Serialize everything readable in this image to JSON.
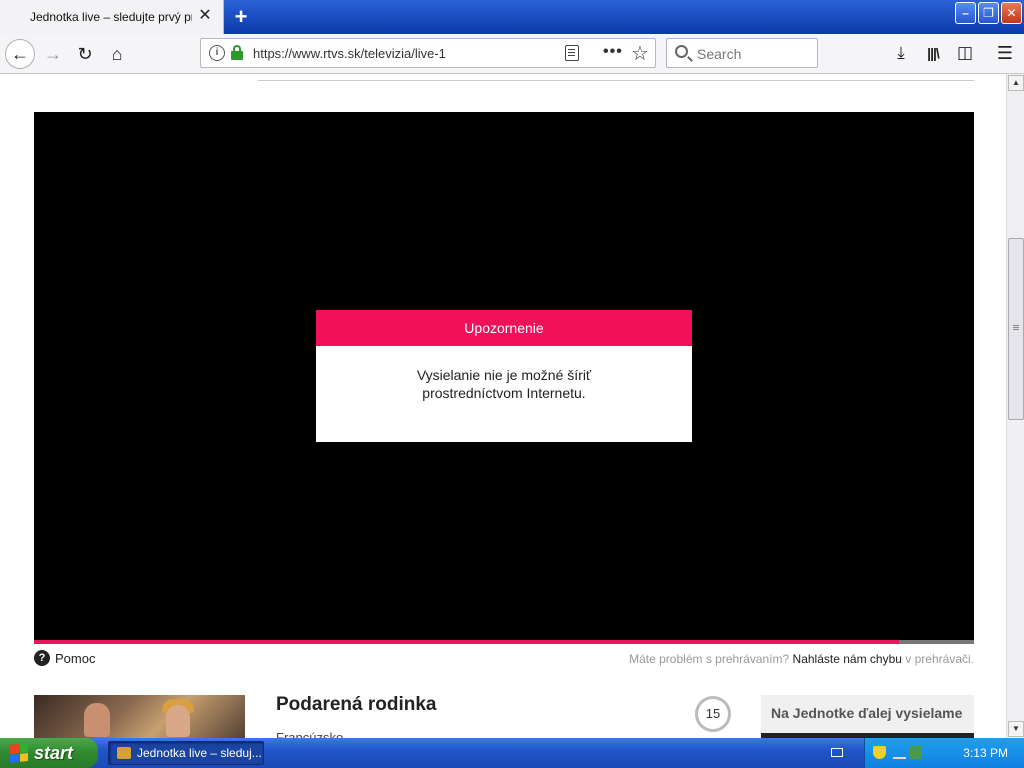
{
  "browser": {
    "tab_title": "Jednotka live – sledujte prvý program",
    "tab_close": "✕",
    "new_tab": "+",
    "window_buttons": {
      "minimize": "–",
      "restore": "❐",
      "close": "✕"
    },
    "url": "https://www.rtvs.sk/televizia/live-1",
    "search_placeholder": "Search",
    "icons": [
      "back-arrow-icon",
      "forward-arrow-icon",
      "reload-icon",
      "home-icon",
      "info-icon",
      "lock-icon",
      "reader-view-icon",
      "more-actions-icon",
      "bookmark-star-icon",
      "search-icon",
      "download-icon",
      "library-icon",
      "sidebar-icon",
      "hamburger-menu-icon"
    ]
  },
  "player": {
    "progress_fraction": 0.92,
    "accent_color": "#e8155a",
    "modal": {
      "title": "Upozornenie",
      "line1": "Vysielanie nie je možné šíriť",
      "line2": "prostredníctvom Internetu."
    }
  },
  "below_player": {
    "help_label": "Pomoc",
    "problem_prefix": "Máte problém s prehrávaním?",
    "problem_link": "Nahláste nám chybu",
    "problem_suffix": "v prehrávači."
  },
  "show": {
    "title": "Podarená rodinka",
    "country": "Francúzsko",
    "age_rating": "15",
    "next_label": "Na Jednotke ďalej vysielame"
  },
  "taskbar": {
    "start_label": "start",
    "task_item": "Jednotka live – sleduj...",
    "clock": "3:13 PM"
  }
}
